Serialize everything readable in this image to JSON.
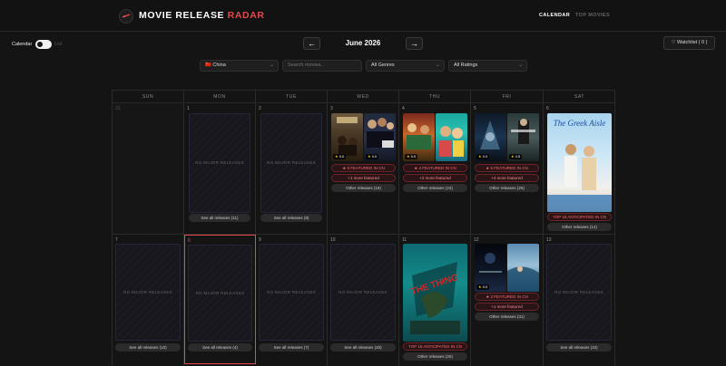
{
  "app": {
    "logo_main": "MOVIE RELEASE ",
    "logo_accent": "RADAR",
    "nav": [
      {
        "label": "CALENDAR",
        "active": true
      },
      {
        "label": "TOP MOVIES",
        "active": false
      }
    ]
  },
  "toolbar": {
    "view_calendar": "Calendar",
    "view_list": "List",
    "prev": "←",
    "next": "→",
    "month": "June 2026",
    "watchlist_label": "♡ Watchlist ( 0 )"
  },
  "filters": {
    "country": "🇨🇳 China",
    "search_placeholder": "Search movies...",
    "genre": "All Genres",
    "rating": "All Ratings"
  },
  "colors": {
    "accent": "#e5484d",
    "background": "#141414",
    "star": "#f5c518"
  },
  "weekdays": [
    "SUN",
    "MON",
    "TUE",
    "WED",
    "THU",
    "FRI",
    "SAT"
  ],
  "weeks": [
    [
      {
        "num": "31",
        "outside": true
      },
      {
        "num": "1",
        "empty_text": "NO MAJOR RELEASES",
        "other": "See all releases (11)"
      },
      {
        "num": "2",
        "empty_text": "NO MAJOR RELEASES",
        "other": "See all releases (8)"
      },
      {
        "num": "3",
        "posters": [
          {
            "name": "movie-poster-peddi",
            "rating": "★ 0.0"
          },
          {
            "name": "movie-poster-scary-movie",
            "rating": "★ 0.0"
          }
        ],
        "featured": "★ 5 FEATURED IN CN",
        "more": "+1 more featured",
        "other": "Other releases (19)"
      },
      {
        "num": "4",
        "posters": [
          {
            "name": "movie-poster-thu-1",
            "rating": "★ 0.0"
          },
          {
            "name": "movie-poster-thu-2",
            "rating": ""
          }
        ],
        "featured": "★ 4 FEATURED IN CN",
        "more": "+2 more featured",
        "other": "Other releases (24)"
      },
      {
        "num": "5",
        "posters": [
          {
            "name": "movie-poster-fri-1",
            "rating": "★ 0.0"
          },
          {
            "name": "movie-poster-fri-2",
            "rating": "★ 4.5"
          }
        ],
        "featured": "★ 5 FEATURED IN CN",
        "more": "+3 more featured",
        "other": "Other releases (26)"
      },
      {
        "num": "6",
        "posters": [
          {
            "name": "movie-poster-the-greek-aisle",
            "title": "The Greek Aisle",
            "rating": ""
          }
        ],
        "featured": "TOP 15 ANTICIPATED IN CN",
        "other": "Other releases (14)"
      }
    ],
    [
      {
        "num": "7",
        "empty_text": "NO MAJOR RELEASES",
        "other": "See all releases (10)"
      },
      {
        "num": "8",
        "today": true,
        "empty_text": "NO MAJOR RELEASES",
        "other": "See all releases (4)"
      },
      {
        "num": "9",
        "empty_text": "NO MAJOR RELEASES",
        "other": "See all releases (7)"
      },
      {
        "num": "10",
        "empty_text": "NO MAJOR RELEASES",
        "other": "See all releases (20)"
      },
      {
        "num": "11",
        "posters": [
          {
            "name": "movie-poster-the-thing",
            "title": "THE THING",
            "rating": ""
          }
        ],
        "featured": "TOP 15 ANTICIPATED IN CN",
        "other": "Other releases (20)"
      },
      {
        "num": "12",
        "posters": [
          {
            "name": "movie-poster-sat-1",
            "rating": "★ 0.0"
          },
          {
            "name": "movie-poster-sat-2",
            "rating": ""
          }
        ],
        "featured": "★ 2 FEATURED IN CN",
        "more": "+1 more featured",
        "other": "Other releases (31)"
      },
      {
        "num": "13",
        "empty_text": "NO MAJOR RELEASES",
        "other": "See all releases (10)"
      }
    ]
  ]
}
